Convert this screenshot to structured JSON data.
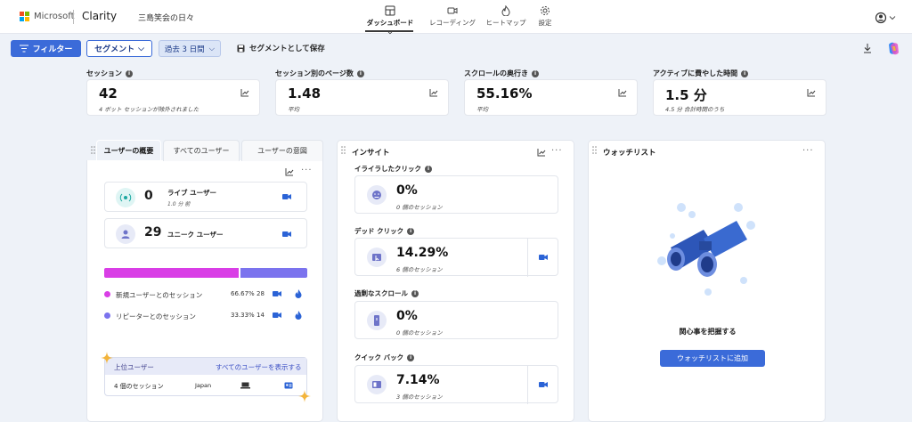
{
  "header": {
    "ms_text": "Microsoft",
    "brand": "Clarity",
    "project": "三島笑会の日々",
    "nav": [
      {
        "label": "ダッシュボード",
        "icon": "dashboard-icon",
        "active": true
      },
      {
        "label": "レコーディング",
        "icon": "recording-icon",
        "active": false
      },
      {
        "label": "ヒートマップ",
        "icon": "heatmap-icon",
        "active": false
      },
      {
        "label": "設定",
        "icon": "gear-icon",
        "active": false
      }
    ]
  },
  "toolbar": {
    "filter_label": "フィルター",
    "segment_label": "セグメント",
    "date_label": "過去 3 日間",
    "save_segment_label": "セグメントとして保存"
  },
  "metrics": [
    {
      "label": "セッション",
      "value": "42",
      "sub": "4 ボット セッションが除外されました"
    },
    {
      "label": "セッション別のページ数",
      "value": "1.48",
      "sub": "平均"
    },
    {
      "label": "スクロールの奥行き",
      "value": "55.16%",
      "sub": "平均"
    },
    {
      "label": "アクティブに費やした時間",
      "value": "1.5 分",
      "sub": "4.5 分 合計時間のうち"
    }
  ],
  "users_panel": {
    "tabs": [
      "ユーザーの概要",
      "すべてのユーザー",
      "ユーザーの意図"
    ],
    "live": {
      "value": "0",
      "label": "ライブ ユーザー",
      "sub": "1.0 分 前"
    },
    "unique": {
      "value": "29",
      "label": "ユニーク ユーザー"
    },
    "split": {
      "new_pct": 66.67,
      "returning_pct": 33.33
    },
    "legend": [
      {
        "label": "新規ユーザーとのセッション",
        "pct": "66.67%",
        "count": "28",
        "color": "#d93ee6"
      },
      {
        "label": "リピーターとのセッション",
        "pct": "33.33%",
        "count": "14",
        "color": "#7b73ee"
      }
    ],
    "top_users": {
      "title": "上位ユーザー",
      "link": "すべてのユーザーを表示する",
      "row": {
        "sessions": "4 個のセッション",
        "country": "Japan"
      }
    }
  },
  "insights_panel": {
    "title": "インサイト",
    "items": [
      {
        "label": "イライラしたクリック",
        "value": "0%",
        "sub": "0 個のセッション",
        "has_recording": false
      },
      {
        "label": "デッド クリック",
        "value": "14.29%",
        "sub": "6 個のセッション",
        "has_recording": true
      },
      {
        "label": "過剰なスクロール",
        "value": "0%",
        "sub": "0 個のセッション",
        "has_recording": false
      },
      {
        "label": "クイック バック",
        "value": "7.14%",
        "sub": "3 個のセッション",
        "has_recording": true
      }
    ]
  },
  "watchlist_panel": {
    "title": "ウォッチリスト",
    "empty_text": "関心事を把握する",
    "add_button": "ウォッチリストに追加"
  },
  "colors": {
    "accent": "#3b6bd9",
    "new_users": "#d93ee6",
    "returning_users": "#7b73ee"
  }
}
